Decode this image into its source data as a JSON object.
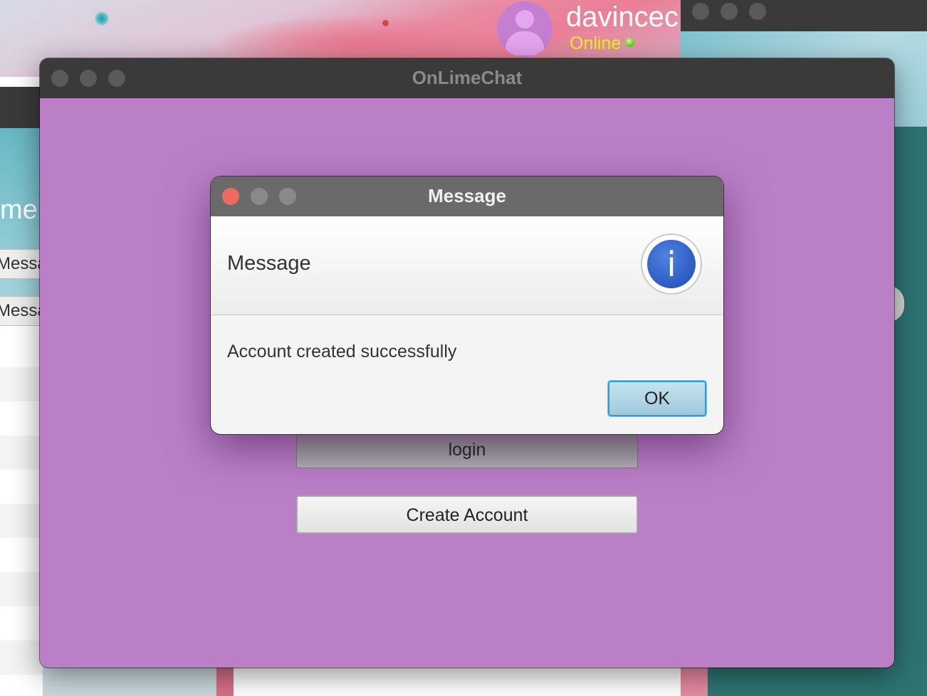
{
  "background": {
    "user": {
      "name": "davincec",
      "status": "Online"
    },
    "left_window": {
      "title_fragment": "me",
      "buttons": [
        "Messa",
        "Messa"
      ]
    }
  },
  "main_window": {
    "title": "OnLimeChat",
    "buttons": {
      "login": "login",
      "create_account": "Create Account"
    },
    "colors": {
      "background": "#bb7fc8",
      "titlebar": "#3a3a3a"
    }
  },
  "dialog": {
    "title": "Message",
    "header": "Message",
    "icon": "info-icon",
    "message": "Account created successfully",
    "ok_label": "OK",
    "colors": {
      "close_button": "#ec6a5e",
      "ok_border": "#2f9bd8"
    }
  }
}
